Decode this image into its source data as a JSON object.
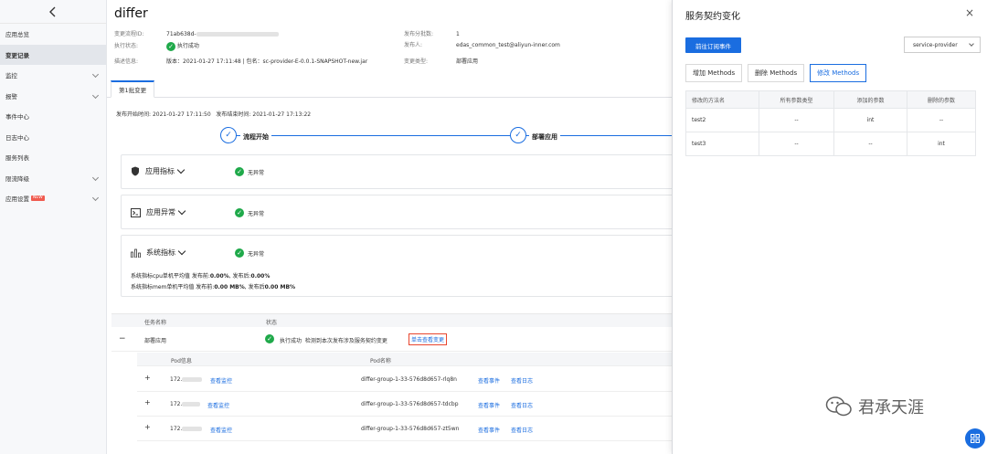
{
  "sidebar": {
    "items": [
      {
        "label": "应用总览"
      },
      {
        "label": "变更记录"
      },
      {
        "label": "监控"
      },
      {
        "label": "报警"
      },
      {
        "label": "事件中心"
      },
      {
        "label": "日志中心"
      },
      {
        "label": "服务列表"
      },
      {
        "label": "限流降级"
      },
      {
        "label": "应用设置",
        "badge": "NEW"
      }
    ]
  },
  "main": {
    "title": "differ",
    "meta": {
      "change_id_label": "变更流程ID:",
      "change_id_value": "71ab638d-",
      "exec_status_label": "执行状态:",
      "exec_status_value": "执行成功",
      "desc_label": "描述信息:",
      "desc_value": "版本：2021-01-27 17:11:48 | 包名：sc-provider-E-0.0.1-SNAPSHOT-new.jar",
      "batch_label": "发布分批数:",
      "batch_value": "1",
      "publisher_label": "发布人:",
      "publisher_value": "edas_common_test@aliyun-inner.com",
      "type_label": "变更类型:",
      "type_value": "部署应用"
    },
    "tab": "第1批变更",
    "time": {
      "start_label": "发布开始时间:",
      "start_value": "2021-01-27 17:11:50",
      "end_label": "发布结束时间:",
      "end_value": "2021-01-27 17:13:22"
    },
    "steps": [
      "流程开始",
      "部署应用"
    ],
    "panels": [
      {
        "title": "应用指标",
        "status": "无异常"
      },
      {
        "title": "应用异常",
        "status": "无异常"
      },
      {
        "title": "系统指标",
        "status": "无异常"
      }
    ],
    "sys_cpu": {
      "label": "系统指标cpu单机平均值 发布前:",
      "before": "0.00%",
      "mid": ", 发布后:",
      "after": "0.00%"
    },
    "sys_mem": {
      "label": "系统指标mem单机平均值 发布前:",
      "before": "0.00 MB%",
      "mid": ", 发布后",
      "after": "0.00 MB%"
    },
    "task_table": {
      "col_name": "任务名称",
      "col_status": "状态",
      "collapse_sign": "−",
      "name": "部署应用",
      "status": "执行成功",
      "status_detail": "检测到本次发布涉及服务契约变更",
      "link": "单击查看变更"
    },
    "pod_table": {
      "col_info": "Pod信息",
      "col_name": "Pod名称",
      "rows": [
        {
          "expand": "+",
          "ip": "172.",
          "monitor": "查看监控",
          "name": "differ-group-1-33-576d8d657-rlq8n",
          "events": "查看事件",
          "logs": "查看日志"
        },
        {
          "expand": "+",
          "ip": "172.",
          "monitor": "查看监控",
          "name": "differ-group-1-33-576d8d657-tdcbp",
          "events": "查看事件",
          "logs": "查看日志"
        },
        {
          "expand": "+",
          "ip": "172.",
          "monitor": "查看监控",
          "name": "differ-group-1-33-576d8d657-zt5wn",
          "events": "查看事件",
          "logs": "查看日志"
        }
      ]
    }
  },
  "drawer": {
    "title": "服务契约变化",
    "close": "×",
    "subscribe_button": "前往订阅事件",
    "select_value": "service-provider",
    "tabs": [
      "增加 Methods",
      "删除 Methods",
      "修改 Methods"
    ],
    "active_tab": 2,
    "table": {
      "headers": [
        "修改的方法名",
        "所有参数类型",
        "添加的参数",
        "删除的参数"
      ],
      "rows": [
        [
          "test2",
          "--",
          "int",
          "--"
        ],
        [
          "test3",
          "--",
          "--",
          "int"
        ]
      ]
    }
  },
  "watermark": "君承天涯",
  "colors": {
    "accent": "#1a6de0",
    "success": "#1fa94a",
    "highlight": "#e8462f"
  }
}
